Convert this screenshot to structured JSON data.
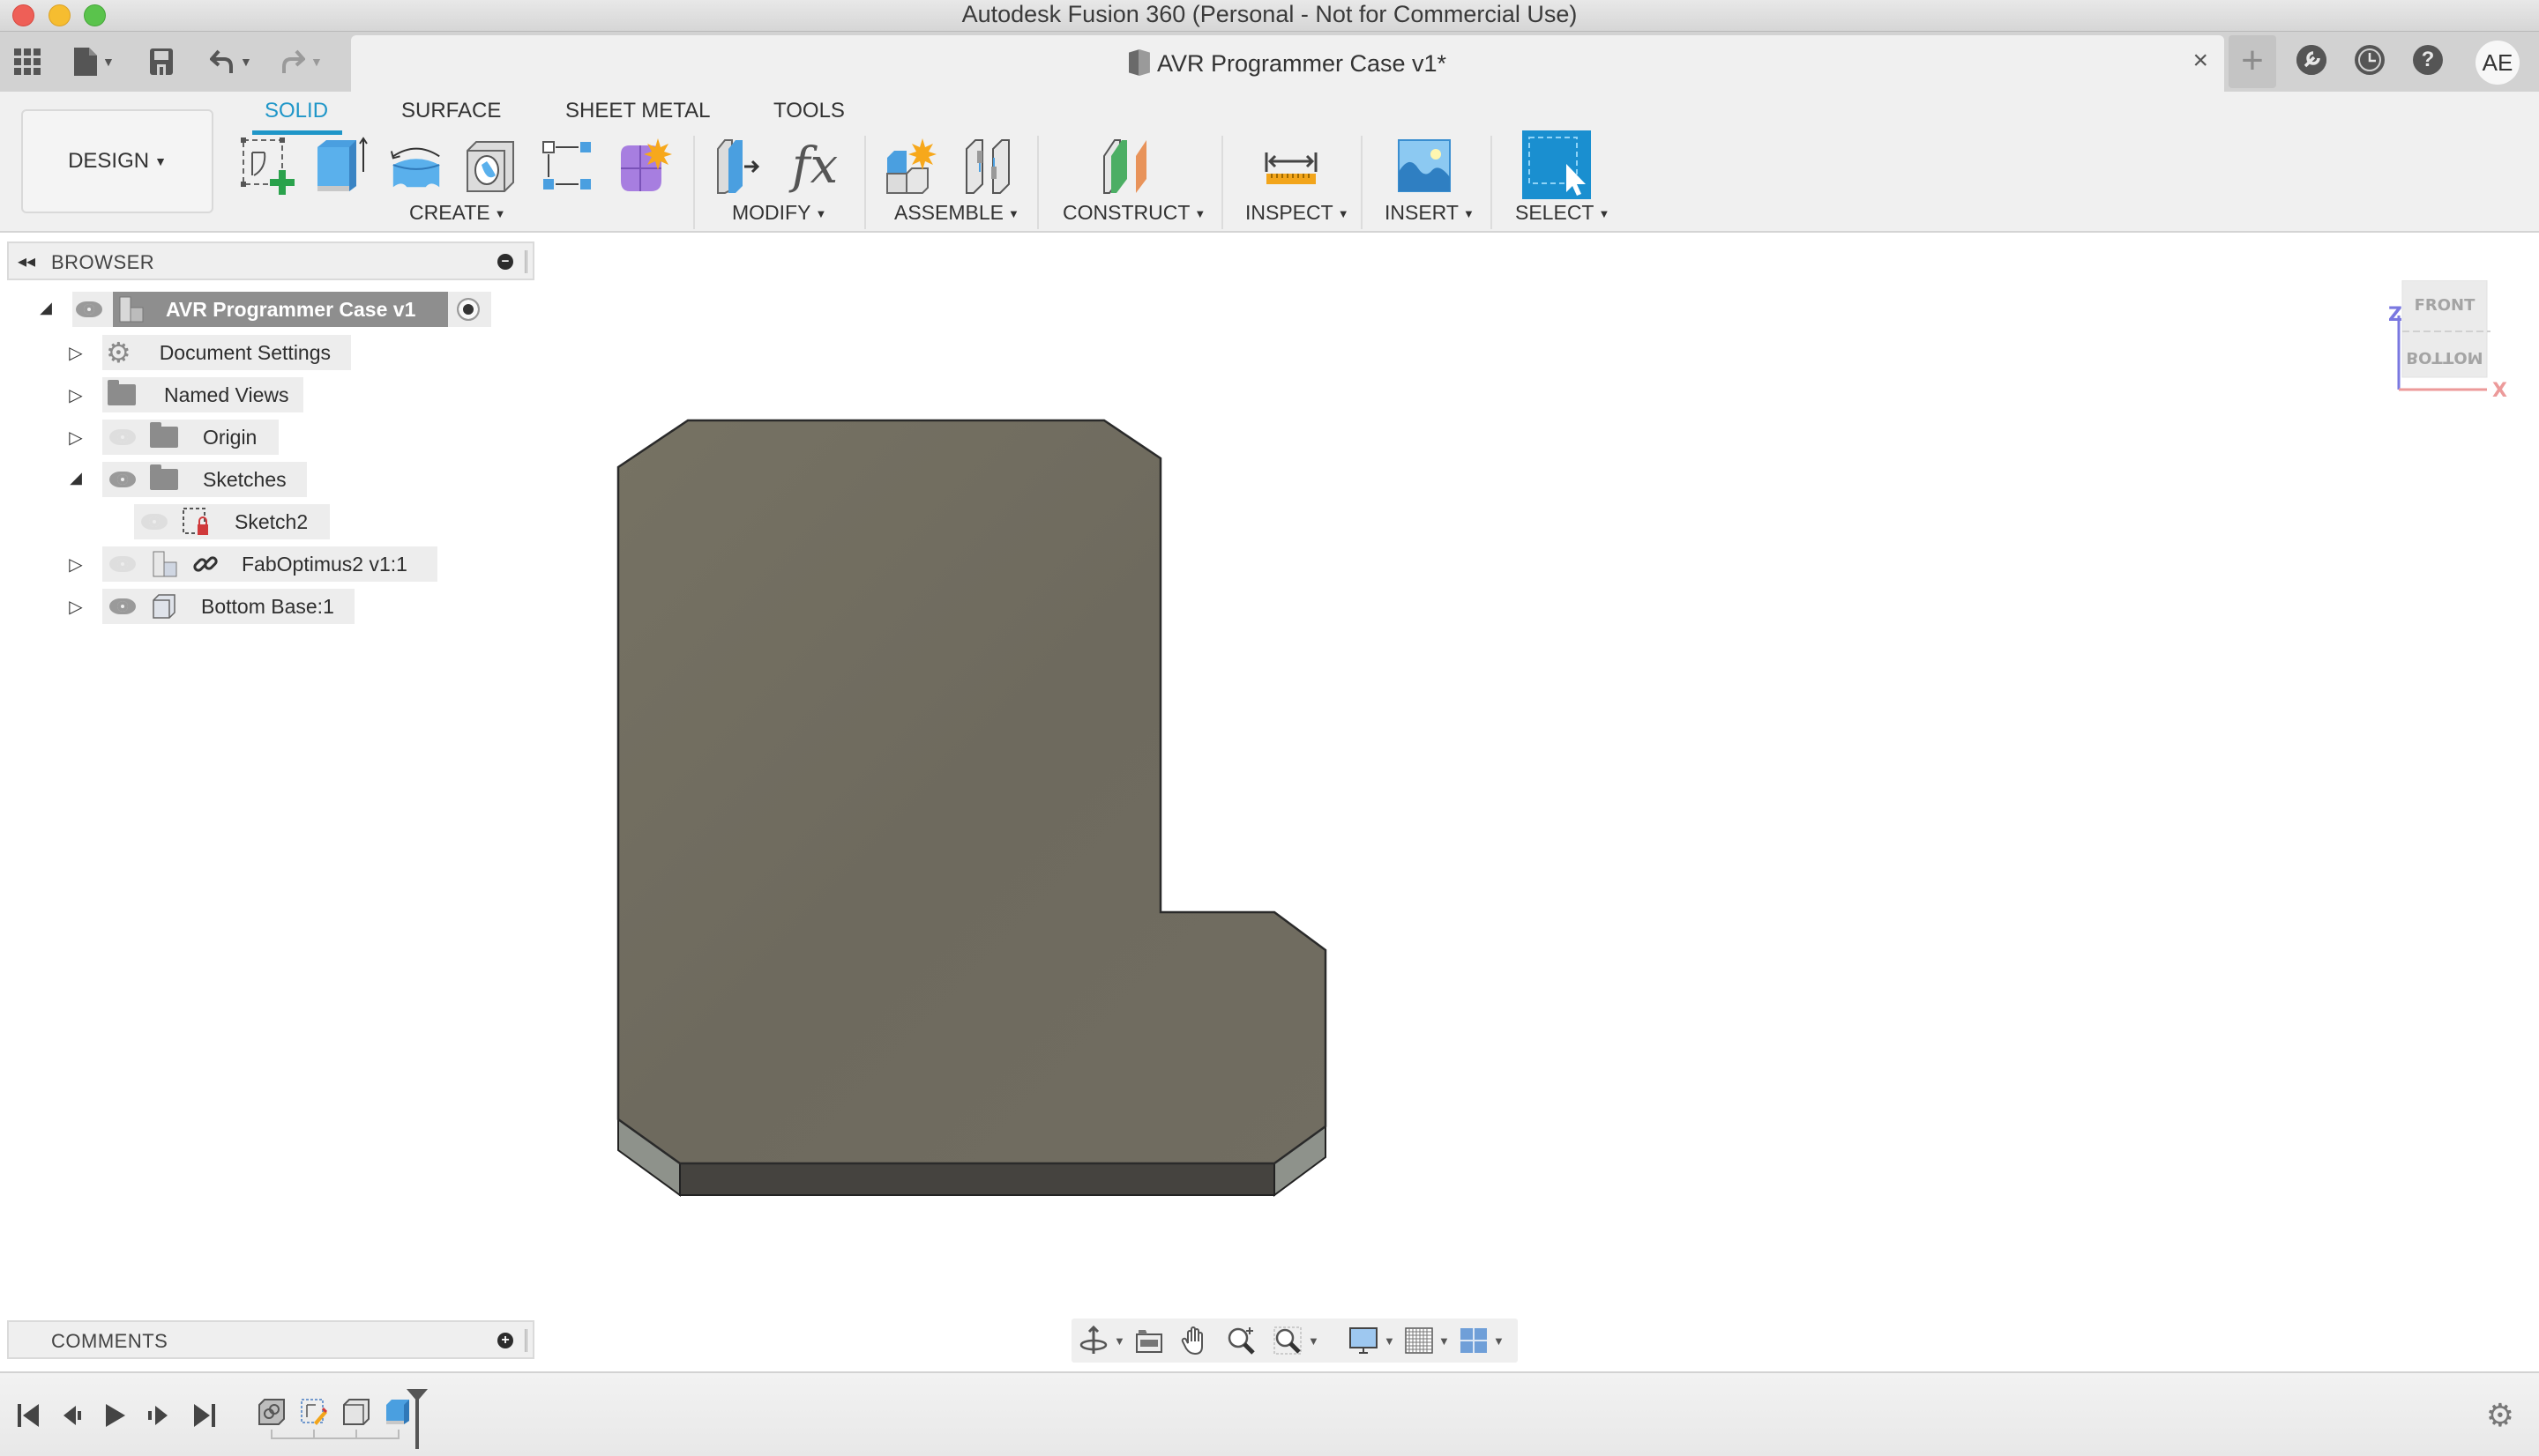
{
  "window": {
    "title": "Autodesk Fusion 360 (Personal - Not for Commercial Use)"
  },
  "quick_access": {
    "icons": [
      "app-grid-icon",
      "file-icon",
      "save-icon",
      "undo-icon",
      "redo-icon"
    ]
  },
  "document_tab": {
    "title": "AVR Programmer Case v1*",
    "close_label": "×"
  },
  "top_right": {
    "new_tab_label": "+",
    "extensions_icon": "wrench-icon",
    "job_status_icon": "clock-icon",
    "help_label": "?",
    "avatar_initials": "AE"
  },
  "workspace": {
    "label": "DESIGN"
  },
  "ribbon": {
    "tabs": [
      {
        "label": "SOLID",
        "active": true
      },
      {
        "label": "SURFACE",
        "active": false
      },
      {
        "label": "SHEET METAL",
        "active": false
      },
      {
        "label": "TOOLS",
        "active": false
      }
    ],
    "groups": [
      {
        "label": "CREATE",
        "tools": [
          "create-sketch-icon",
          "extrude-icon",
          "revolve-icon",
          "hole-icon",
          "pattern-icon",
          "create-form-icon"
        ]
      },
      {
        "label": "MODIFY",
        "tools": [
          "press-pull-icon",
          "parameters-fx-icon"
        ]
      },
      {
        "label": "ASSEMBLE",
        "tools": [
          "new-component-icon",
          "joint-icon"
        ]
      },
      {
        "label": "CONSTRUCT",
        "tools": [
          "offset-plane-icon"
        ]
      },
      {
        "label": "INSPECT",
        "tools": [
          "measure-icon"
        ]
      },
      {
        "label": "INSERT",
        "tools": [
          "insert-image-icon"
        ]
      },
      {
        "label": "SELECT",
        "tools": [
          "select-window-icon"
        ]
      }
    ],
    "fx_label": "fx"
  },
  "browser": {
    "title": "BROWSER",
    "root": {
      "label": "AVR Programmer Case v1",
      "expanded": true,
      "visible": true
    },
    "items": [
      {
        "label": "Document Settings",
        "icon": "gear-icon",
        "expanded": false
      },
      {
        "label": "Named Views",
        "icon": "folder-icon",
        "expanded": false
      },
      {
        "label": "Origin",
        "icon": "folder-icon",
        "expanded": false,
        "visible": false
      },
      {
        "label": "Sketches",
        "icon": "folder-icon",
        "expanded": true,
        "visible": true
      },
      {
        "label": "Sketch2",
        "icon": "sketch-locked-icon",
        "visible": false,
        "child": true
      },
      {
        "label": "FabOptimus2 v1:1",
        "icon": "component-icon",
        "linked": true,
        "expanded": false,
        "visible": false
      },
      {
        "label": "Bottom Base:1",
        "icon": "body-icon",
        "expanded": false,
        "visible": true
      }
    ]
  },
  "viewcube": {
    "face_top": "FRONT",
    "face_bottom": "BOTTOM",
    "axis_z": "Z",
    "axis_x": "X"
  },
  "comments": {
    "title": "COMMENTS"
  },
  "nav_toolbar": {
    "tools": [
      "orbit-icon",
      "look-at-icon",
      "pan-icon",
      "zoom-icon",
      "fit-icon",
      "display-settings-icon",
      "grid-icon",
      "viewports-icon"
    ]
  },
  "timeline": {
    "controls": [
      "go-to-start-icon",
      "step-back-icon",
      "play-icon",
      "step-forward-icon",
      "go-to-end-icon"
    ],
    "features": [
      "derive-icon",
      "sketch-icon",
      "body-icon",
      "extrude-icon"
    ]
  },
  "colors": {
    "accent": "#1f96c8",
    "model_face": "#716d61",
    "model_side": "#45433f",
    "model_chamfer": "#8e928b"
  }
}
